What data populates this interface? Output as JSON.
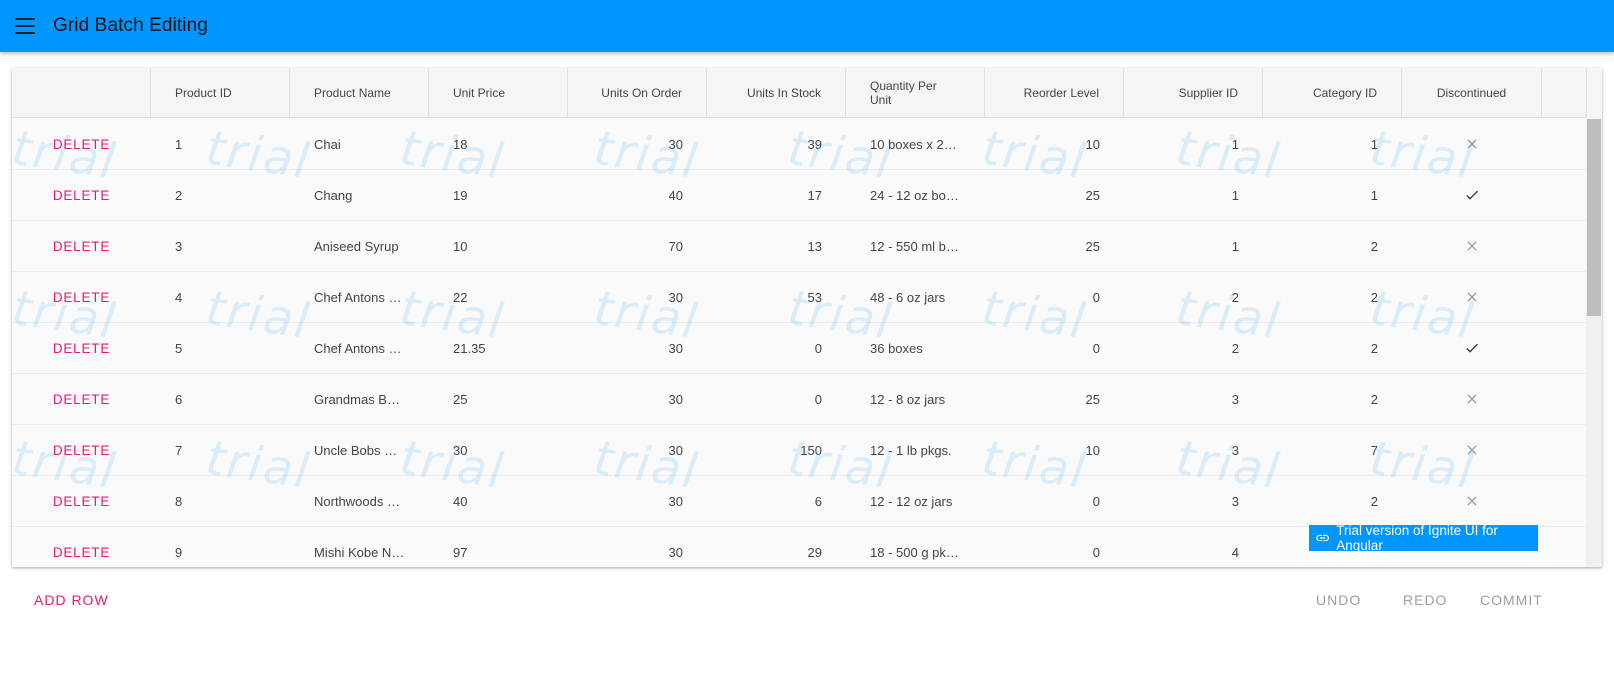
{
  "app": {
    "title": "Grid Batch Editing",
    "accent_color": "#0096ff",
    "menu_icon": "menu-icon"
  },
  "grid": {
    "columns": [
      {
        "key": "delete",
        "label": "",
        "align": "center"
      },
      {
        "key": "product_id",
        "label": "Product ID",
        "align": "left"
      },
      {
        "key": "product_name",
        "label": "Product Name",
        "align": "left"
      },
      {
        "key": "unit_price",
        "label": "Unit Price",
        "align": "left"
      },
      {
        "key": "units_on_order",
        "label": "Units On Order",
        "align": "right"
      },
      {
        "key": "units_in_stock",
        "label": "Units In Stock",
        "align": "right"
      },
      {
        "key": "quantity_per_unit",
        "label": "Quantity Per Unit",
        "align": "left"
      },
      {
        "key": "reorder_level",
        "label": "Reorder Level",
        "align": "right"
      },
      {
        "key": "supplier_id",
        "label": "Supplier ID",
        "align": "right"
      },
      {
        "key": "category_id",
        "label": "Category ID",
        "align": "right"
      },
      {
        "key": "discontinued",
        "label": "Discontinued",
        "align": "center"
      }
    ],
    "delete_label": "DELETE",
    "rows": [
      {
        "product_id": "1",
        "product_name": "Chai",
        "unit_price": "18",
        "units_on_order": "30",
        "units_in_stock": "39",
        "quantity_per_unit": "10 boxes x 20 b...",
        "reorder_level": "10",
        "supplier_id": "1",
        "category_id": "1",
        "discontinued": "false"
      },
      {
        "product_id": "2",
        "product_name": "Chang",
        "unit_price": "19",
        "units_on_order": "40",
        "units_in_stock": "17",
        "quantity_per_unit": "24 - 12 oz bottl...",
        "reorder_level": "25",
        "supplier_id": "1",
        "category_id": "1",
        "discontinued": "true"
      },
      {
        "product_id": "3",
        "product_name": "Aniseed Syrup",
        "unit_price": "10",
        "units_on_order": "70",
        "units_in_stock": "13",
        "quantity_per_unit": "12 - 550 ml bo...",
        "reorder_level": "25",
        "supplier_id": "1",
        "category_id": "2",
        "discontinued": "false"
      },
      {
        "product_id": "4",
        "product_name": "Chef Antons Ca...",
        "unit_price": "22",
        "units_on_order": "30",
        "units_in_stock": "53",
        "quantity_per_unit": "48 - 6 oz jars",
        "reorder_level": "0",
        "supplier_id": "2",
        "category_id": "2",
        "discontinued": "false"
      },
      {
        "product_id": "5",
        "product_name": "Chef Antons Gu...",
        "unit_price": "21.35",
        "units_on_order": "30",
        "units_in_stock": "0",
        "quantity_per_unit": "36 boxes",
        "reorder_level": "0",
        "supplier_id": "2",
        "category_id": "2",
        "discontinued": "true"
      },
      {
        "product_id": "6",
        "product_name": "Grandmas Boy...",
        "unit_price": "25",
        "units_on_order": "30",
        "units_in_stock": "0",
        "quantity_per_unit": "12 - 8 oz jars",
        "reorder_level": "25",
        "supplier_id": "3",
        "category_id": "2",
        "discontinued": "false"
      },
      {
        "product_id": "7",
        "product_name": "Uncle Bobs Org...",
        "unit_price": "30",
        "units_on_order": "30",
        "units_in_stock": "150",
        "quantity_per_unit": "12 - 1 lb pkgs.",
        "reorder_level": "10",
        "supplier_id": "3",
        "category_id": "7",
        "discontinued": "false"
      },
      {
        "product_id": "8",
        "product_name": "Northwoods Cr...",
        "unit_price": "40",
        "units_on_order": "30",
        "units_in_stock": "6",
        "quantity_per_unit": "12 - 12 oz jars",
        "reorder_level": "0",
        "supplier_id": "3",
        "category_id": "2",
        "discontinued": "false"
      },
      {
        "product_id": "9",
        "product_name": "Mishi Kobe Niku",
        "unit_price": "97",
        "units_on_order": "30",
        "units_in_stock": "29",
        "quantity_per_unit": "18 - 500 g pkgs.",
        "reorder_level": "0",
        "supplier_id": "4",
        "category_id": "",
        "discontinued": ""
      }
    ],
    "watermark_text": "trial",
    "scroll_position": 0.0
  },
  "trial_badge": {
    "text": "Trial version of Ignite UI for Angular",
    "icon": "link-icon"
  },
  "footer": {
    "add_row": "ADD ROW",
    "undo": "UNDO",
    "redo": "REDO",
    "commit": "COMMIT",
    "primary_color": "#e41c77",
    "disabled_color": "#9e9e9e"
  }
}
